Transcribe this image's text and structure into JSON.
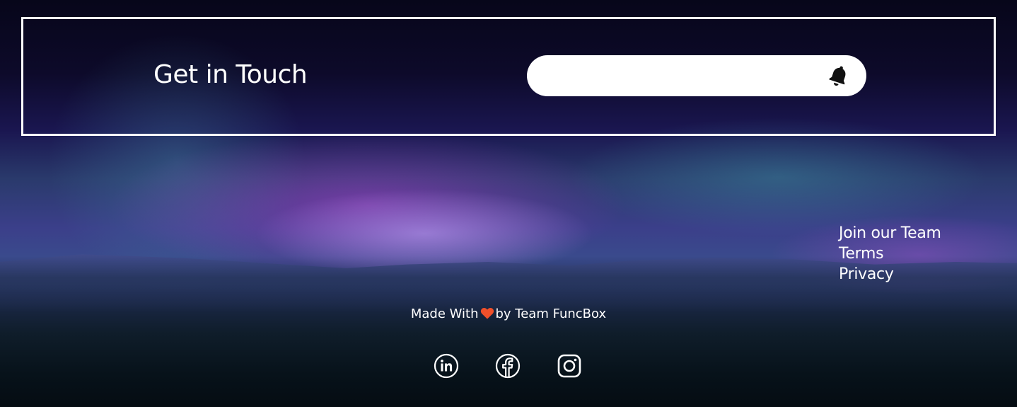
{
  "contact": {
    "title": "Get in Touch",
    "email_value": "",
    "email_placeholder": "",
    "submit_icon": "bell-icon"
  },
  "footer_links": [
    {
      "label": "Join our Team"
    },
    {
      "label": "Terms"
    },
    {
      "label": "Privacy"
    }
  ],
  "credit": {
    "prefix": "Made With",
    "heart_icon": "heart-icon",
    "suffix": "by Team FuncBox",
    "heart_color": "#f0502a"
  },
  "socials": [
    {
      "icon": "linkedin-icon"
    },
    {
      "icon": "facebook-icon"
    },
    {
      "icon": "instagram-icon"
    }
  ]
}
